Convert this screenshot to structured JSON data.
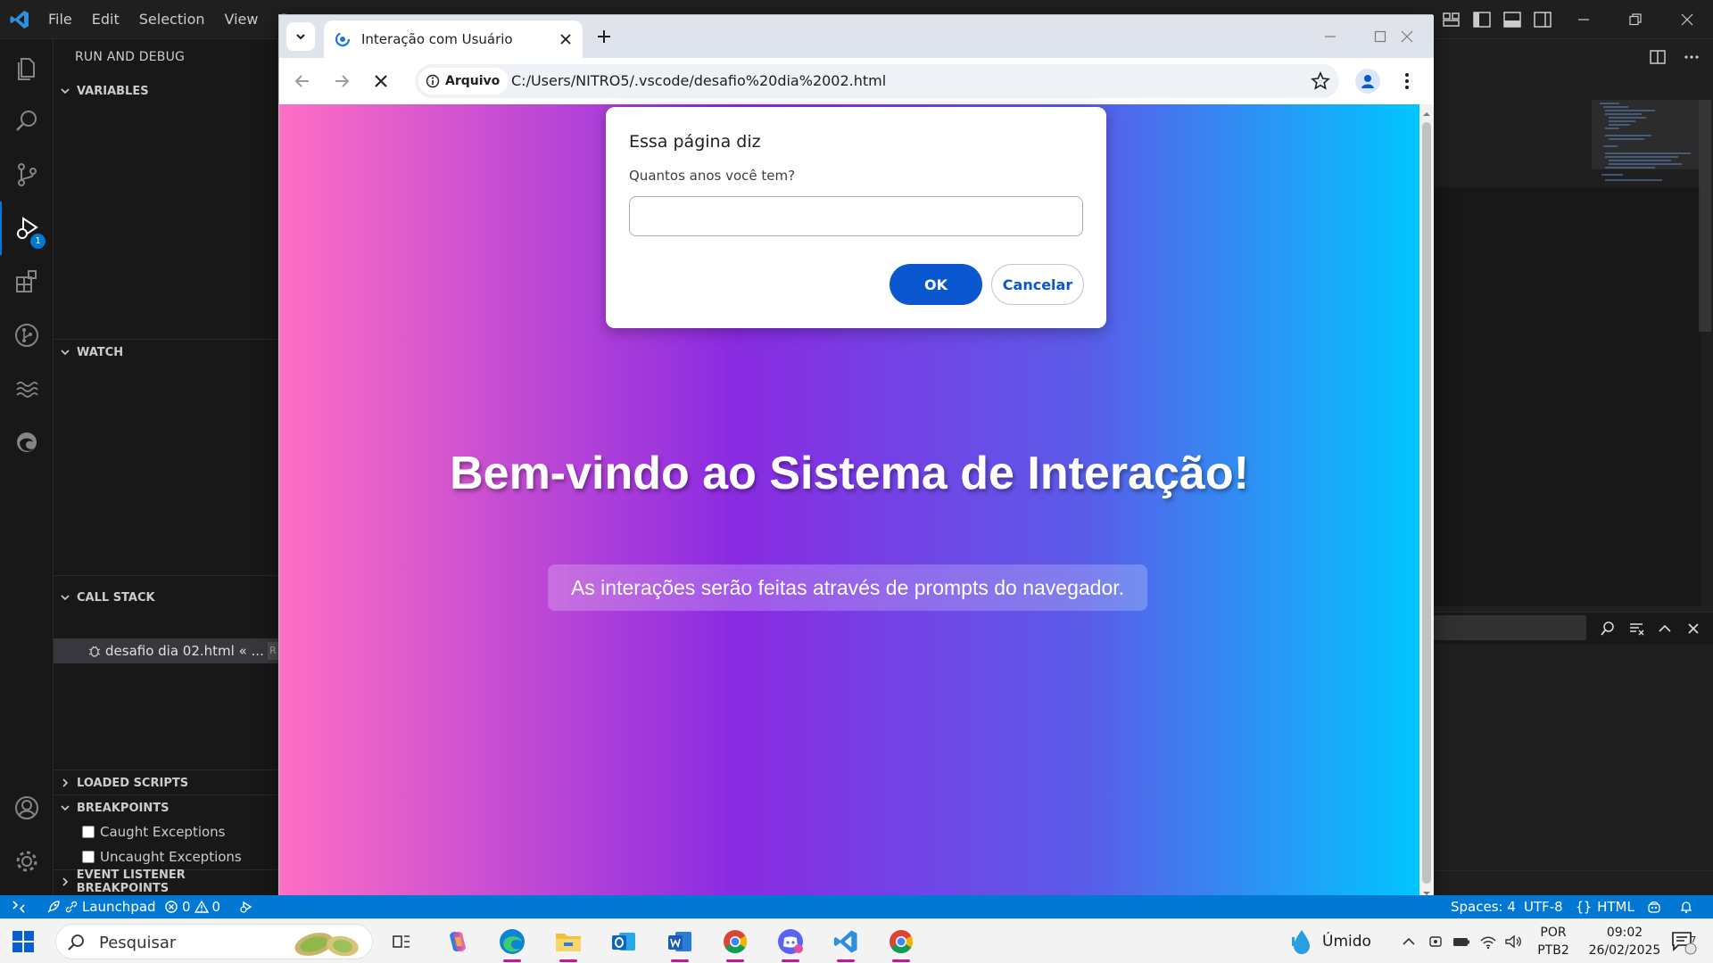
{
  "vscode": {
    "menu": [
      "File",
      "Edit",
      "Selection",
      "View",
      "Go"
    ],
    "sidebar": {
      "title": "RUN AND DEBUG",
      "sections": {
        "variables": "VARIABLES",
        "watch": "WATCH",
        "call_stack": "CALL STACK",
        "loaded_scripts": "LOADED SCRIPTS",
        "breakpoints": "BREAKPOINTS",
        "event_listener_breakpoints": "EVENT LISTENER BREAKPOINTS"
      },
      "call_stack_item": "desafio dia 02.html « ...",
      "call_stack_badge": "R",
      "breakpoint_items": [
        "Caught Exceptions",
        "Uncaught Exceptions"
      ]
    },
    "activity_badge": "1",
    "statusbar": {
      "launchpad": "Launchpad",
      "errors": "0",
      "warnings": "0",
      "spaces": "Spaces: 4",
      "encoding": "UTF-8",
      "language": "HTML"
    },
    "colors": {
      "statusbar": "#0078d4",
      "accent": "#0078d4"
    }
  },
  "chrome": {
    "tab_title": "Interação com Usuário",
    "security_chip": "Arquivo",
    "url": "C:/Users/NITRO5/.vscode/desafio%20dia%2002.html",
    "page": {
      "heading": "Bem-vindo ao Sistema de Interação!",
      "paragraph": "As interações serão feitas através de prompts do navegador."
    },
    "dialog": {
      "title": "Essa página diz",
      "message": "Quantos anos você tem?",
      "input_value": "",
      "ok_label": "OK",
      "cancel_label": "Cancelar"
    },
    "colors": {
      "gradient": [
        "#ff6ec4",
        "#8a2be2",
        "#5c5ae8",
        "#00c6ff"
      ],
      "button": "#0b57d0"
    }
  },
  "taskbar": {
    "search_placeholder": "Pesquisar",
    "weather": "Úmido",
    "lang_top": "POR",
    "lang_bottom": "PTB2",
    "time": "09:02",
    "date": "26/02/2025",
    "notifications": "7",
    "apps": [
      "task-view",
      "copilot",
      "edge",
      "file-explorer",
      "outlook",
      "word",
      "chrome",
      "discord",
      "vscode",
      "chrome"
    ]
  }
}
